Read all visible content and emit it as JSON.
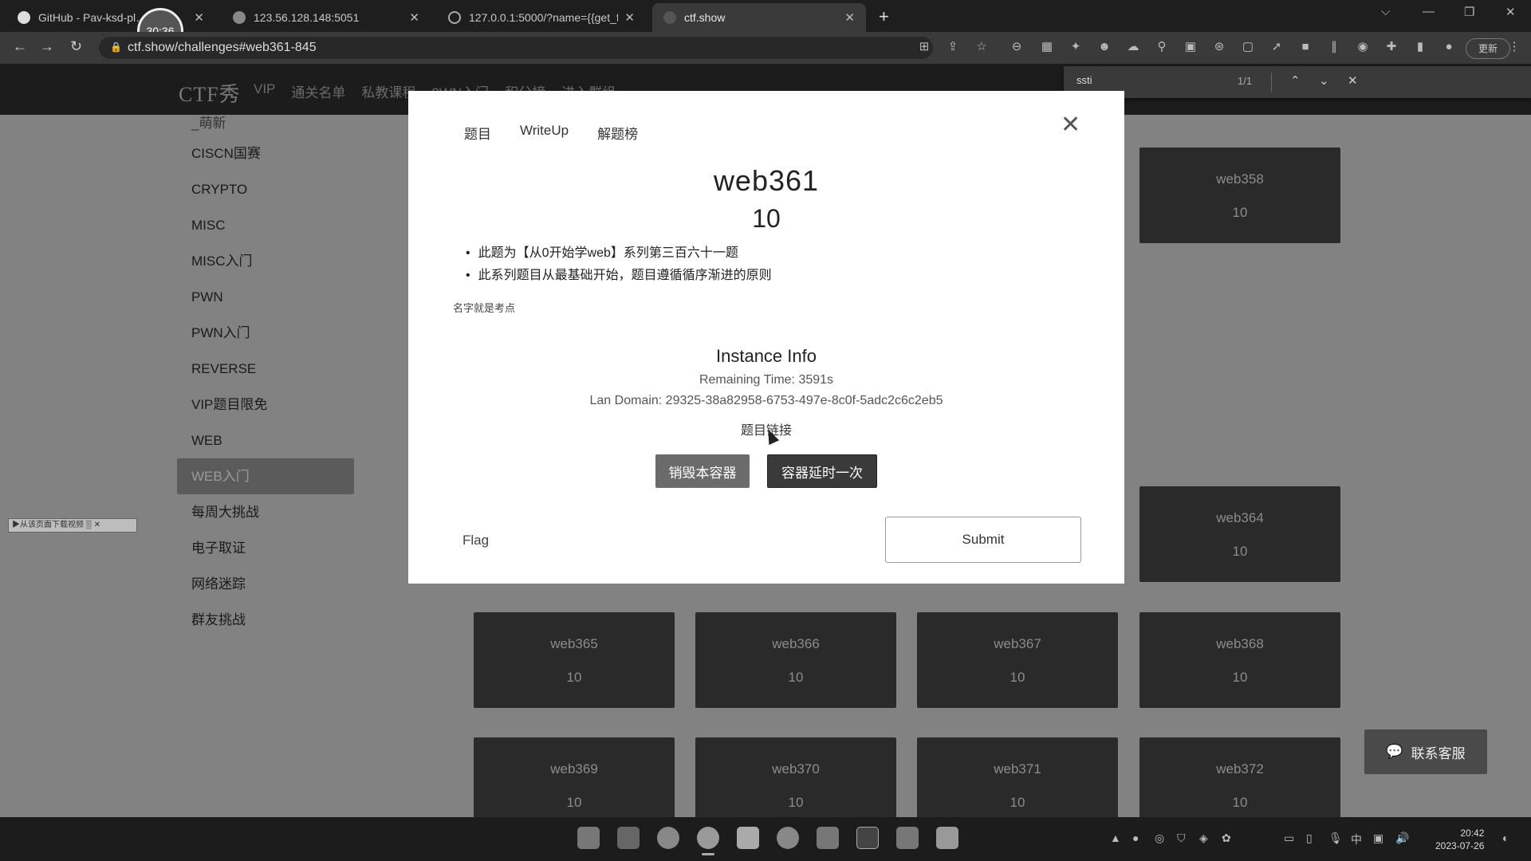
{
  "browser": {
    "tabs": [
      {
        "title": "GitHub - Pav-ksd-pl…es\\",
        "icon": "github-icon"
      },
      {
        "title": "123.56.128.148:5051",
        "icon": "bird-icon"
      },
      {
        "title": "127.0.0.1:5000/?name={{get_fl",
        "icon": "globe-icon"
      },
      {
        "title": "ctf.show",
        "icon": "ctfshow-icon"
      }
    ],
    "timer_badge": "30:36",
    "url": "ctf.show/challenges#web361-845",
    "update_label": "更新"
  },
  "find_bar": {
    "query": "ssti",
    "count": "1/1"
  },
  "site": {
    "logo": "CTF秀",
    "nav": [
      "VIP",
      "通关名单",
      "私教课程",
      "0WN入门",
      "积分榜",
      "进入群组"
    ]
  },
  "sidebar": {
    "items": [
      {
        "label": "_萌新"
      },
      {
        "label": "CISCN国赛"
      },
      {
        "label": "CRYPTO"
      },
      {
        "label": "MISC"
      },
      {
        "label": "MISC入门"
      },
      {
        "label": "PWN"
      },
      {
        "label": "PWN入门"
      },
      {
        "label": "REVERSE"
      },
      {
        "label": "VIP题目限免"
      },
      {
        "label": "WEB"
      },
      {
        "label": "WEB入门"
      },
      {
        "label": "每周大挑战"
      },
      {
        "label": "电子取证"
      },
      {
        "label": "网络迷踪"
      },
      {
        "label": "群友挑战"
      }
    ]
  },
  "download_strip": "▶从该页面下载视频 ▒ ✕",
  "cards": [
    {
      "name": "web358",
      "score": "10"
    },
    {
      "name": "web364",
      "score": "10"
    },
    {
      "name": "web365",
      "score": "10"
    },
    {
      "name": "web366",
      "score": "10"
    },
    {
      "name": "web367",
      "score": "10"
    },
    {
      "name": "web368",
      "score": "10"
    },
    {
      "name": "web369",
      "score": "10"
    },
    {
      "name": "web370",
      "score": "10"
    },
    {
      "name": "web371",
      "score": "10"
    },
    {
      "name": "web372",
      "score": "10"
    }
  ],
  "contact_button": "联系客服",
  "modal": {
    "tabs": [
      "题目",
      "WriteUp",
      "解题榜"
    ],
    "title": "web361",
    "score": "10",
    "description": [
      "此题为【从0开始学web】系列第三百六十一题",
      "此系列题目从最基础开始，题目遵循循序渐进的原则"
    ],
    "hint": "名字就是考点",
    "instance": {
      "heading": "Instance Info",
      "remaining": "Remaining Time: 3591s",
      "domain": "Lan Domain: 29325-38a82958-6753-497e-8c0f-5adc2c6c2eb5",
      "link_label": "题目链接",
      "destroy_label": "销毁本容器",
      "extend_label": "容器延时一次"
    },
    "flag_label": "Flag",
    "submit_label": "Submit"
  },
  "taskbar": {
    "time": "20:42",
    "date": "2023-07-26",
    "ime": "中"
  }
}
